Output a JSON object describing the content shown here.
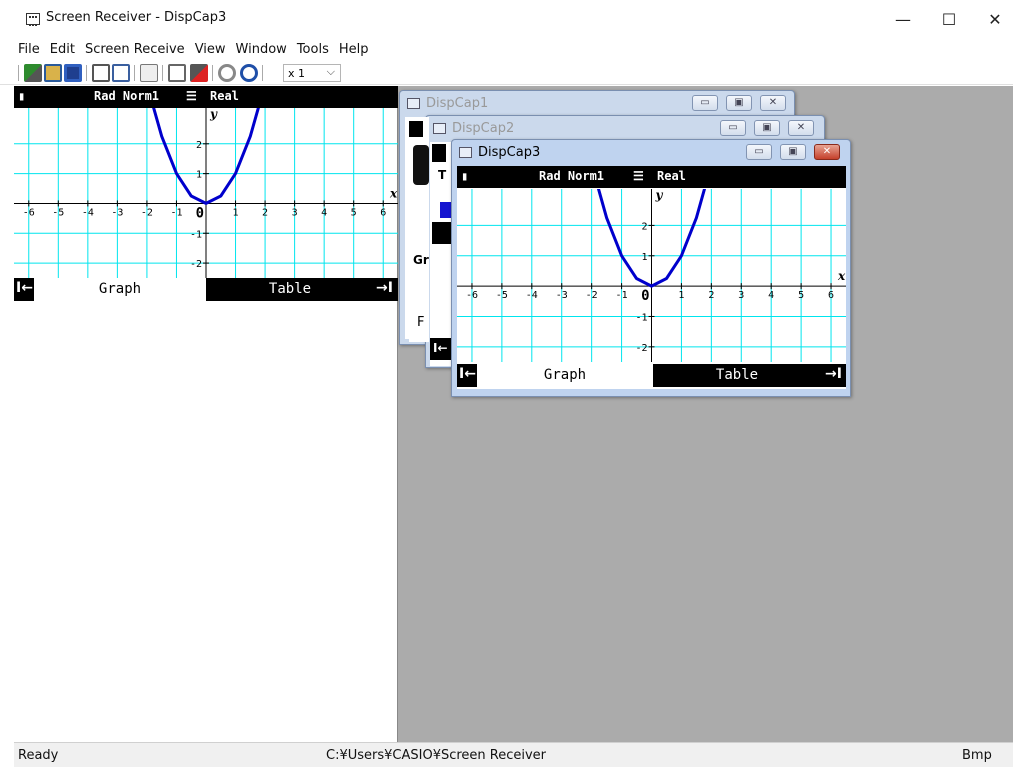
{
  "window": {
    "title": "Screen Receiver - DispCap3",
    "minimize": "—",
    "maximize": "☐",
    "close": "✕"
  },
  "menu": [
    "File",
    "Edit",
    "Screen Receive",
    "View",
    "Window",
    "Tools",
    "Help"
  ],
  "toolbar": {
    "zoom": "x 1",
    "zoom_arrow": "⌵"
  },
  "main_calc": {
    "status": {
      "mode": "Rad Norm1",
      "number_mode": "Real"
    },
    "tabs": {
      "left_arrow": "I←",
      "graph": "Graph",
      "table": "Table",
      "right_arrow": "→I"
    }
  },
  "child_windows": [
    {
      "title": "DispCap1"
    },
    {
      "title": "DispCap2",
      "partial": [
        "T",
        "Gr",
        "F"
      ]
    },
    {
      "title": "DispCap3"
    }
  ],
  "status_bar": {
    "left": "Ready",
    "path": "C:¥Users¥CASIO¥Screen Receiver",
    "format": "Bmp"
  },
  "chart_data": {
    "type": "line",
    "function": "y = x^2",
    "xlim": [
      -6.5,
      6.5
    ],
    "ylim": [
      -2.5,
      3.2
    ],
    "xlabel": "x",
    "ylabel": "y",
    "xticks": [
      -6,
      -5,
      -4,
      -3,
      -2,
      -1,
      1,
      2,
      3,
      4,
      5,
      6
    ],
    "yticks": [
      -2,
      -1,
      1,
      2
    ],
    "origin_label": "0",
    "grid": true,
    "grid_color": "#00e5ee",
    "curve_color": "#0000cc",
    "series": [
      {
        "x": [
          -2,
          -1.5,
          -1,
          -0.5,
          0,
          0.5,
          1,
          1.5,
          2
        ],
        "values": [
          4,
          2.25,
          1,
          0.25,
          0,
          0.25,
          1,
          2.25,
          4
        ]
      }
    ]
  }
}
